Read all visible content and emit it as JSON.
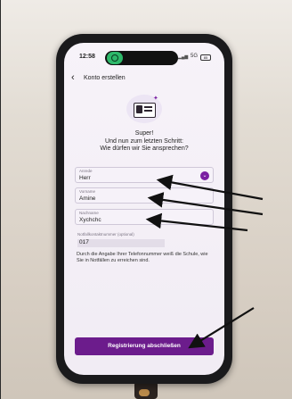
{
  "status_bar": {
    "time": "12:58",
    "network": "5G",
    "battery": "85"
  },
  "header": {
    "back_icon": "chevron-left-icon",
    "title": "Konto erstellen"
  },
  "intro": {
    "line1": "Super!",
    "line2": "Und nun zum letzten Schritt:",
    "line3": "Wie dürfen wir Sie ansprechen?"
  },
  "form": {
    "salutation": {
      "label": "Anrede",
      "value": "Herr"
    },
    "first_name": {
      "label": "Vorname",
      "value": "Amine"
    },
    "last_name": {
      "label": "Nachname",
      "value": "Xychchc"
    },
    "emergency_phone": {
      "label": "Notfallkontaktnummer (optional)",
      "value": "017"
    }
  },
  "helper_text": "Durch die Angabe Ihrer Telefonnummer weiß die Schule, wie Sie in Notfällen zu erreichen sind.",
  "submit_button": {
    "label": "Registrierung abschließen"
  },
  "colors": {
    "accent": "#6c1c8c",
    "arrow": "#111111"
  }
}
